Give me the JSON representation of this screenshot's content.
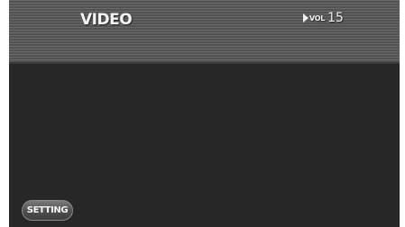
{
  "header": {
    "title": "VIDEO",
    "volume_label": "VOL",
    "volume_value": "15",
    "volume_icon": "speaker-triangle-icon"
  },
  "controls": {
    "setting_label": "SETTING"
  },
  "colors": {
    "screen_background": "#272727",
    "header_stripe_light": "#6a6a6a",
    "header_stripe_dark": "#525252",
    "text": "#f4f4f4"
  }
}
